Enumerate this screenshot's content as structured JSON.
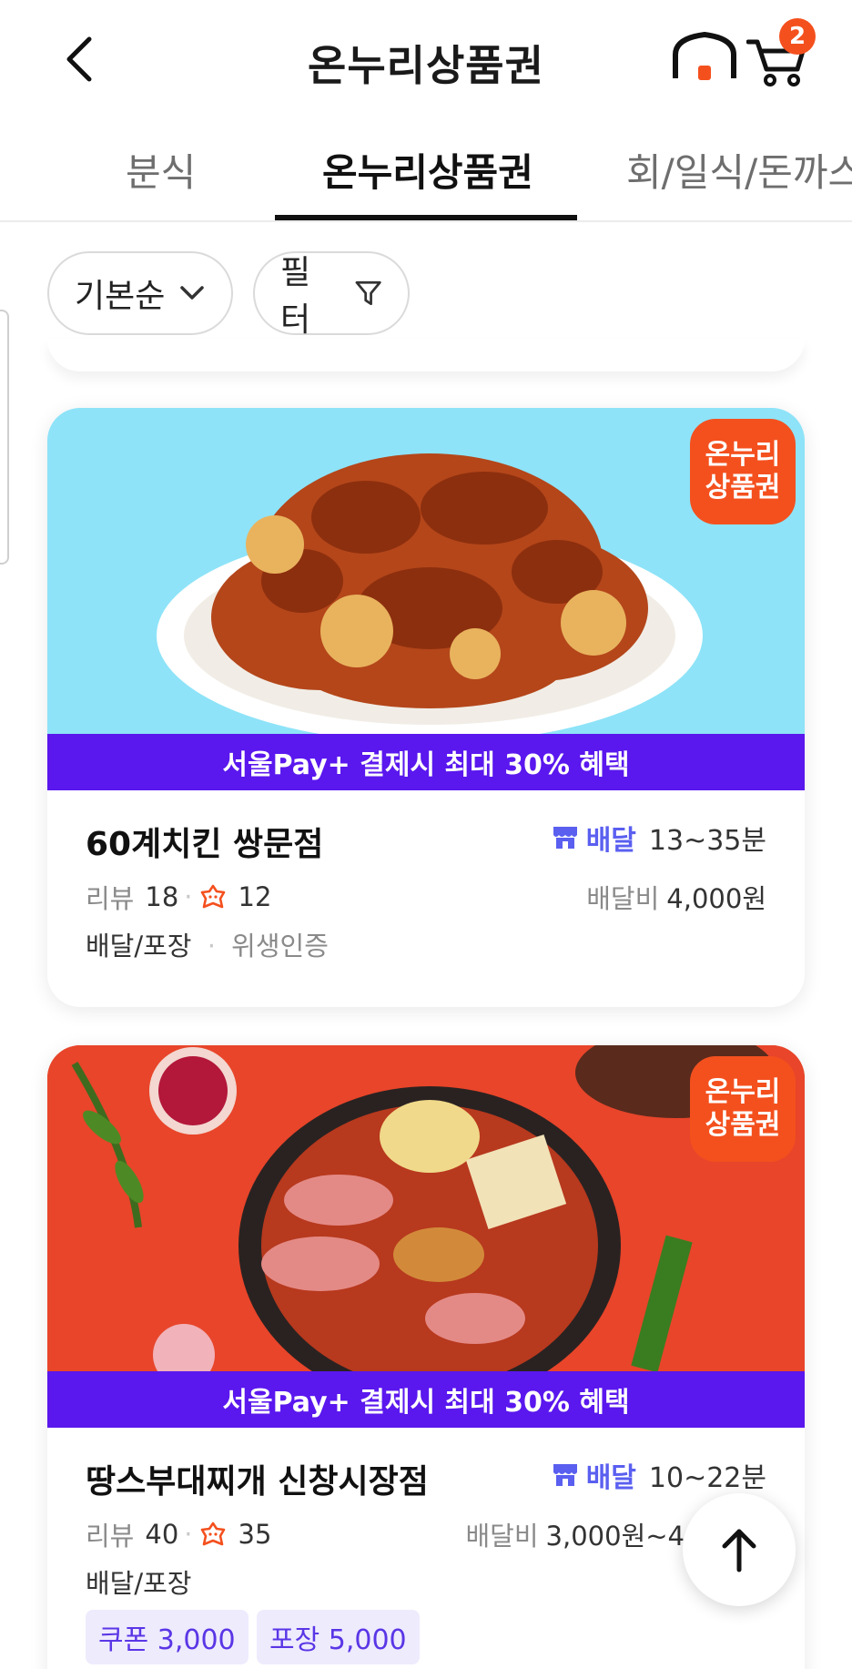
{
  "header": {
    "title": "온누리상품권",
    "cart_count": "2",
    "accent": "#f4501e"
  },
  "tabs": [
    {
      "label": "분식",
      "active": false
    },
    {
      "label": "온누리상품권",
      "active": true
    },
    {
      "label": "회/일식/돈까스",
      "active": false
    }
  ],
  "filters": {
    "sort_label": "기본순",
    "filter_label": "필터"
  },
  "stores": [
    {
      "name": "60계치킨 쌍문점",
      "promo": "서울Pay+ 결제시 최대 30% 혜택",
      "badge_line1": "온누리",
      "badge_line2": "상품권",
      "delivery_label": "배달",
      "delivery_time": "13~35분",
      "review_label": "리뷰",
      "review_count": "18",
      "owner_count": "12",
      "fee_label": "배달비",
      "fee_value": "4,000원",
      "method": "배달/포장",
      "cert": "위생인증",
      "image_bg": "#8ee3f8"
    },
    {
      "name": "땅스부대찌개 신창시장점",
      "promo": "서울Pay+ 결제시 최대 30% 혜택",
      "badge_line1": "온누리",
      "badge_line2": "상품권",
      "delivery_label": "배달",
      "delivery_time": "10~22분",
      "review_label": "리뷰",
      "review_count": "40",
      "owner_count": "35",
      "fee_label": "배달비",
      "fee_value": "3,000원~4",
      "method": "배달/포장",
      "coupons": [
        "쿠폰 3,000",
        "포장 5,000"
      ],
      "image_bg": "#e8452a"
    }
  ],
  "colors": {
    "promo_bar": "#5a17ee",
    "delivery_accent": "#5a5ff0",
    "coupon_bg": "#eeebfd"
  },
  "icons": [
    "back-arrow-icon",
    "home-icon",
    "cart-icon",
    "chevron-down-icon",
    "filter-funnel-icon",
    "store-awning-icon",
    "owner-comment-icon",
    "arrow-up-icon"
  ]
}
